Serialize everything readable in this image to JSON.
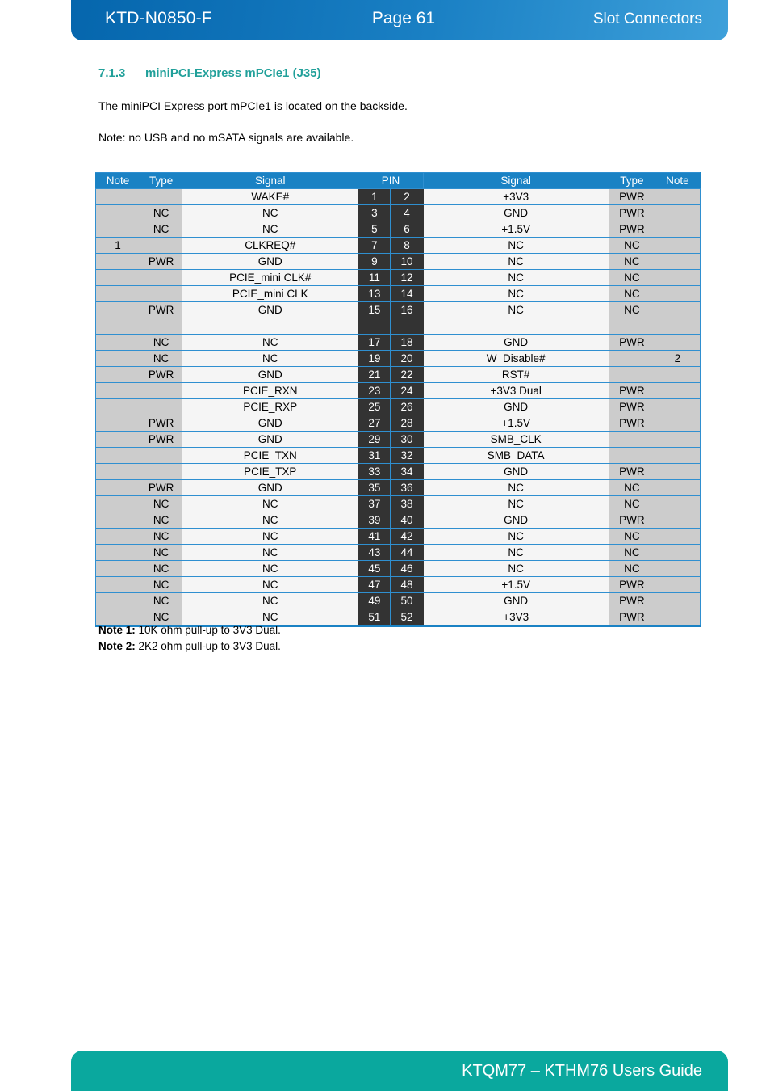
{
  "header": {
    "doc_code": "KTD-N0850-F",
    "page_label": "Page 61",
    "section_title": "Slot Connectors",
    "bg_color_left": "#0566ad",
    "bg_color_right": "#3ea0da"
  },
  "footer": {
    "title": "KTQM77 – KTHM76 Users Guide",
    "bg_color": "#0aa89e"
  },
  "content": {
    "heading_number": "7.1.3",
    "heading_text": "miniPCI-Express mPCIe1 (J35)",
    "heading_color": "#21a09a",
    "paragraph1": "The miniPCI Express port mPCIe1 is located on the backside.",
    "paragraph2": "Note: no USB and no mSATA signals are available."
  },
  "table": {
    "header_bg": "#1a82c4",
    "pin_bg": "#333333",
    "shade_bg": "#cccccc",
    "headers": [
      "Note",
      "Type",
      "Signal",
      "PIN",
      "Signal",
      "Type",
      "Note"
    ],
    "rows": [
      {
        "note_l": "",
        "type_l": "",
        "sig_l": "WAKE#",
        "pin_l": "1",
        "pin_r": "2",
        "sig_r": "+3V3",
        "type_r": "PWR",
        "note_r": ""
      },
      {
        "note_l": "",
        "type_l": "NC",
        "sig_l": "NC",
        "pin_l": "3",
        "pin_r": "4",
        "sig_r": "GND",
        "type_r": "PWR",
        "note_r": ""
      },
      {
        "note_l": "",
        "type_l": "NC",
        "sig_l": "NC",
        "pin_l": "5",
        "pin_r": "6",
        "sig_r": "+1.5V",
        "type_r": "PWR",
        "note_r": ""
      },
      {
        "note_l": "1",
        "type_l": "",
        "sig_l": "CLKREQ#",
        "pin_l": "7",
        "pin_r": "8",
        "sig_r": "NC",
        "type_r": "NC",
        "note_r": ""
      },
      {
        "note_l": "",
        "type_l": "PWR",
        "sig_l": "GND",
        "pin_l": "9",
        "pin_r": "10",
        "sig_r": "NC",
        "type_r": "NC",
        "note_r": ""
      },
      {
        "note_l": "",
        "type_l": "",
        "sig_l": "PCIE_mini CLK#",
        "pin_l": "11",
        "pin_r": "12",
        "sig_r": "NC",
        "type_r": "NC",
        "note_r": ""
      },
      {
        "note_l": "",
        "type_l": "",
        "sig_l": "PCIE_mini CLK",
        "pin_l": "13",
        "pin_r": "14",
        "sig_r": "NC",
        "type_r": "NC",
        "note_r": ""
      },
      {
        "note_l": "",
        "type_l": "PWR",
        "sig_l": "GND",
        "pin_l": "15",
        "pin_r": "16",
        "sig_r": "NC",
        "type_r": "NC",
        "note_r": ""
      },
      {
        "note_l": "",
        "type_l": "",
        "sig_l": "",
        "pin_l": "",
        "pin_r": "",
        "sig_r": "",
        "type_r": "",
        "note_r": "",
        "gap": true
      },
      {
        "note_l": "",
        "type_l": "NC",
        "sig_l": "NC",
        "pin_l": "17",
        "pin_r": "18",
        "sig_r": "GND",
        "type_r": "PWR",
        "note_r": ""
      },
      {
        "note_l": "",
        "type_l": "NC",
        "sig_l": "NC",
        "pin_l": "19",
        "pin_r": "20",
        "sig_r": "W_Disable#",
        "type_r": "",
        "note_r": "2"
      },
      {
        "note_l": "",
        "type_l": "PWR",
        "sig_l": "GND",
        "pin_l": "21",
        "pin_r": "22",
        "sig_r": "RST#",
        "type_r": "",
        "note_r": ""
      },
      {
        "note_l": "",
        "type_l": "",
        "sig_l": "PCIE_RXN",
        "pin_l": "23",
        "pin_r": "24",
        "sig_r": "+3V3 Dual",
        "type_r": "PWR",
        "note_r": ""
      },
      {
        "note_l": "",
        "type_l": "",
        "sig_l": "PCIE_RXP",
        "pin_l": "25",
        "pin_r": "26",
        "sig_r": "GND",
        "type_r": "PWR",
        "note_r": ""
      },
      {
        "note_l": "",
        "type_l": "PWR",
        "sig_l": "GND",
        "pin_l": "27",
        "pin_r": "28",
        "sig_r": "+1.5V",
        "type_r": "PWR",
        "note_r": ""
      },
      {
        "note_l": "",
        "type_l": "PWR",
        "sig_l": "GND",
        "pin_l": "29",
        "pin_r": "30",
        "sig_r": "SMB_CLK",
        "type_r": "",
        "note_r": ""
      },
      {
        "note_l": "",
        "type_l": "",
        "sig_l": "PCIE_TXN",
        "pin_l": "31",
        "pin_r": "32",
        "sig_r": "SMB_DATA",
        "type_r": "",
        "note_r": ""
      },
      {
        "note_l": "",
        "type_l": "",
        "sig_l": "PCIE_TXP",
        "pin_l": "33",
        "pin_r": "34",
        "sig_r": "GND",
        "type_r": "PWR",
        "note_r": ""
      },
      {
        "note_l": "",
        "type_l": "PWR",
        "sig_l": "GND",
        "pin_l": "35",
        "pin_r": "36",
        "sig_r": "NC",
        "type_r": "NC",
        "note_r": ""
      },
      {
        "note_l": "",
        "type_l": "NC",
        "sig_l": "NC",
        "pin_l": "37",
        "pin_r": "38",
        "sig_r": "NC",
        "type_r": "NC",
        "note_r": ""
      },
      {
        "note_l": "",
        "type_l": "NC",
        "sig_l": "NC",
        "pin_l": "39",
        "pin_r": "40",
        "sig_r": "GND",
        "type_r": "PWR",
        "note_r": ""
      },
      {
        "note_l": "",
        "type_l": "NC",
        "sig_l": "NC",
        "pin_l": "41",
        "pin_r": "42",
        "sig_r": "NC",
        "type_r": "NC",
        "note_r": ""
      },
      {
        "note_l": "",
        "type_l": "NC",
        "sig_l": "NC",
        "pin_l": "43",
        "pin_r": "44",
        "sig_r": "NC",
        "type_r": "NC",
        "note_r": ""
      },
      {
        "note_l": "",
        "type_l": "NC",
        "sig_l": "NC",
        "pin_l": "45",
        "pin_r": "46",
        "sig_r": "NC",
        "type_r": "NC",
        "note_r": ""
      },
      {
        "note_l": "",
        "type_l": "NC",
        "sig_l": "NC",
        "pin_l": "47",
        "pin_r": "48",
        "sig_r": "+1.5V",
        "type_r": "PWR",
        "note_r": ""
      },
      {
        "note_l": "",
        "type_l": "NC",
        "sig_l": "NC",
        "pin_l": "49",
        "pin_r": "50",
        "sig_r": "GND",
        "type_r": "PWR",
        "note_r": ""
      },
      {
        "note_l": "",
        "type_l": "NC",
        "sig_l": "NC",
        "pin_l": "51",
        "pin_r": "52",
        "sig_r": "+3V3",
        "type_r": "PWR",
        "note_r": ""
      }
    ]
  },
  "notes": [
    {
      "label": "Note 1:",
      "text": " 10K ohm pull-up to 3V3 Dual."
    },
    {
      "label": "Note 2:",
      "text": " 2K2 ohm pull-up to 3V3 Dual."
    }
  ]
}
